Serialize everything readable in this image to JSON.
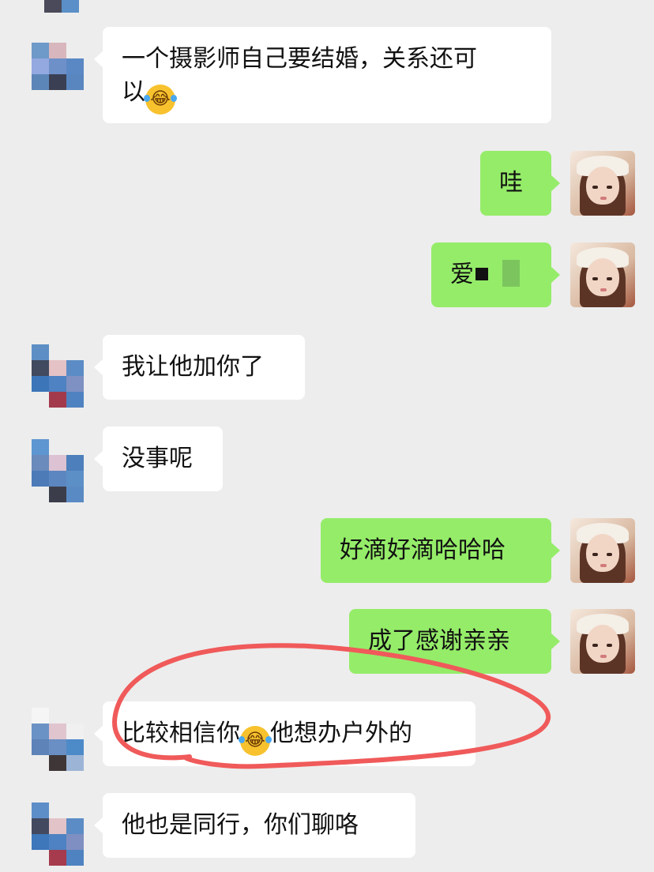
{
  "colors": {
    "background": "#ededed",
    "bubble_in": "#ffffff",
    "bubble_out": "#95ec69",
    "annotation": "#f05a5a"
  },
  "messages": [
    {
      "side": "left",
      "line1": "一个摄影师自己要结婚，关系还可",
      "line2": "以"
    },
    {
      "side": "right",
      "text": "哇"
    },
    {
      "side": "right",
      "text": "爱"
    },
    {
      "side": "left",
      "text": "我让他加你了"
    },
    {
      "side": "left",
      "text": "没事呢"
    },
    {
      "side": "right",
      "text": "好滴好滴哈哈哈"
    },
    {
      "side": "right",
      "text": "成了感谢亲亲"
    },
    {
      "side": "left",
      "text_before": "比较相信你",
      "text_after": "他想办户外的"
    },
    {
      "side": "left",
      "text": "他也是同行，你们聊咯"
    }
  ],
  "icons": {
    "laugh_emoji": "face-with-tears-of-joy-icon",
    "self_avatar": "avatar-photo",
    "contact_avatar": "avatar-mosaic"
  },
  "emoji_glyph": "😂"
}
